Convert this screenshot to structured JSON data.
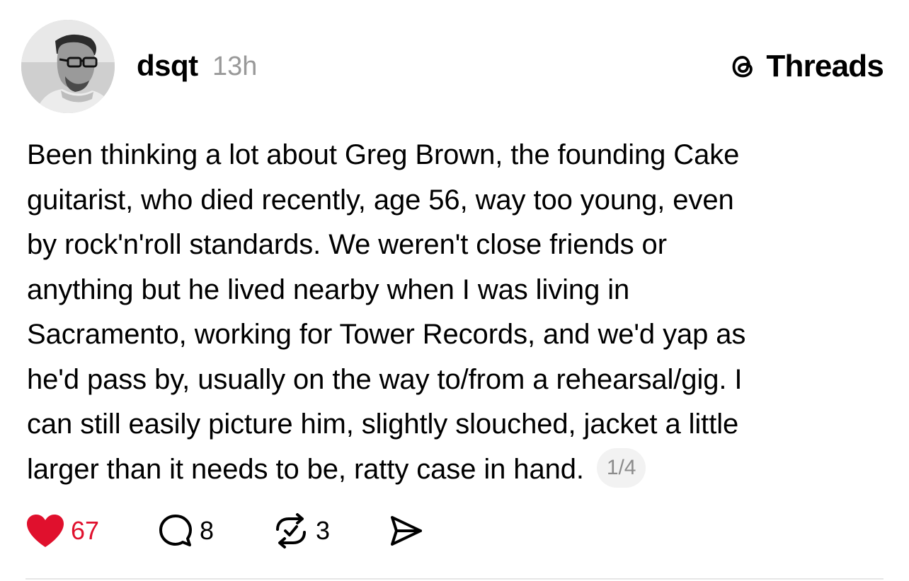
{
  "post": {
    "author": "dsqt",
    "time": "13h",
    "brand": "Threads",
    "text_lines": [
      "Been thinking a lot about Greg Brown, the founding Cake",
      "guitarist, who died recently, age 56, way too young, even",
      "by rock'n'roll standards. We weren't close friends or",
      "anything but he lived nearby when I was living in",
      "Sacramento, working for Tower Records, and we'd yap as",
      "he'd pass by, usually on the way to/from a rehearsal/gig. I",
      "can still easily picture him, slightly slouched, jacket a little",
      "larger than it needs to be, ratty case in hand."
    ],
    "page_indicator": "1/4"
  },
  "actions": {
    "likes": "67",
    "replies": "8",
    "reposts": "3"
  },
  "colors": {
    "like": "#e0102d",
    "muted": "#999999",
    "pill_bg": "#f2f2f2",
    "divider": "#e6e6e6"
  },
  "icons": {
    "avatar": "avatar-photo",
    "brand": "threads-logo-icon",
    "like": "heart-icon",
    "reply": "comment-icon",
    "repost": "repost-icon",
    "share": "send-icon"
  }
}
